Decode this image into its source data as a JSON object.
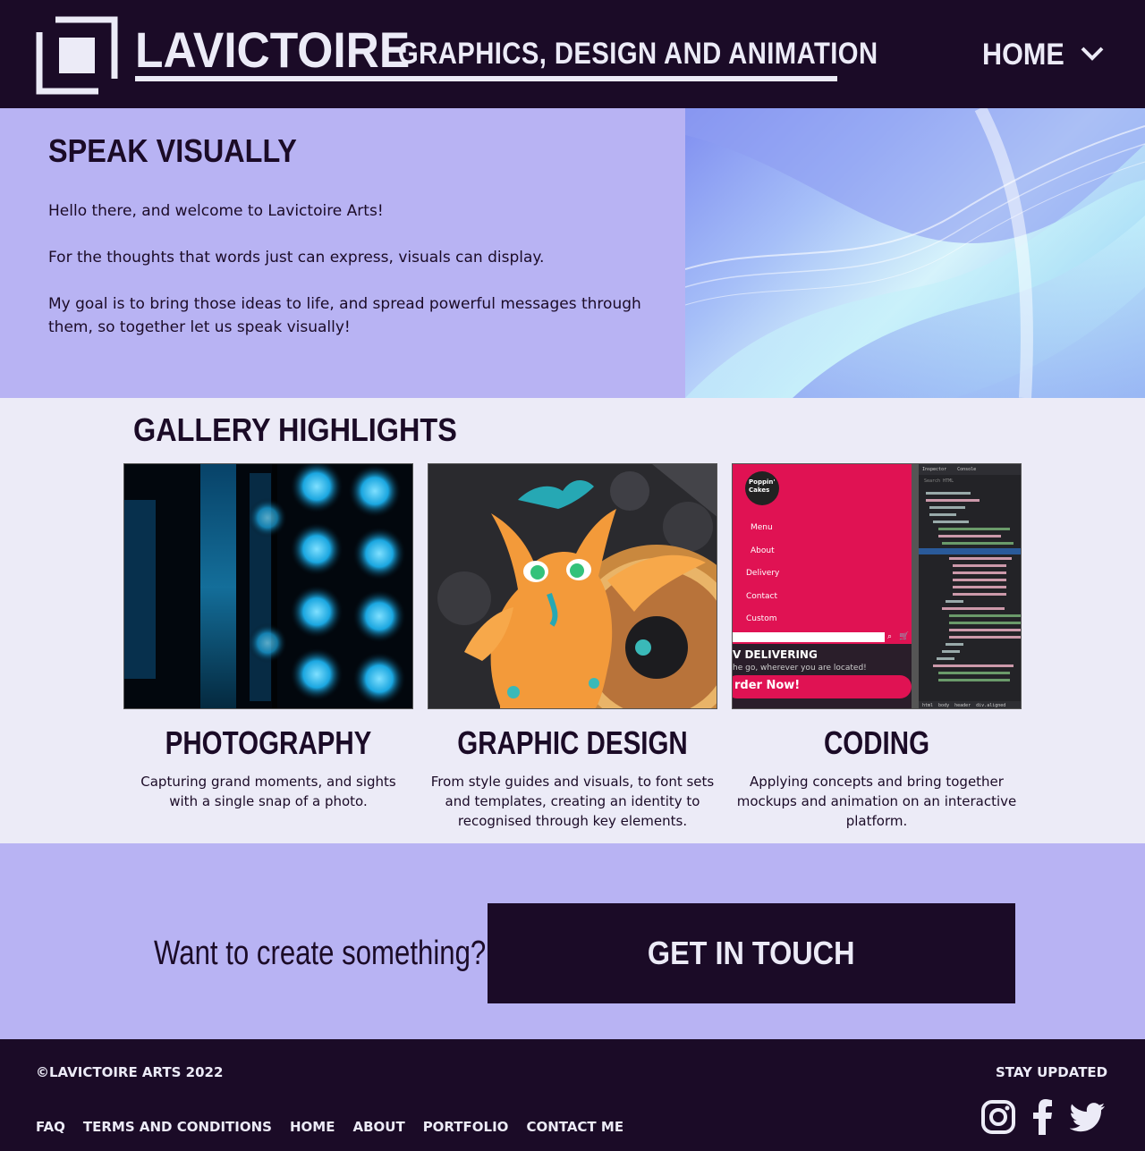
{
  "header": {
    "brand": "LAVICTOIRE",
    "tagline": "GRAPHICS, DESIGN AND ANIMATION",
    "nav_label": "HOME"
  },
  "hero": {
    "title": "SPEAK VISUALLY",
    "paragraphs": [
      "Hello there, and welcome to Lavictoire Arts!",
      "For the thoughts that words just can express, visuals can display.",
      "My goal is to bring those ideas to life, and spread powerful messages through them, so together let us speak visually!"
    ]
  },
  "gallery": {
    "title": "GALLERY HIGHLIGHTS",
    "cards": [
      {
        "title": "PHOTOGRAPHY",
        "description": "Capturing grand moments, and sights with a single snap of a photo."
      },
      {
        "title": "GRAPHIC DESIGN",
        "description": "From style guides and visuals, to font sets and templates, creating an identity to recognised through key elements."
      },
      {
        "title": "CODING",
        "description": "Applying concepts and bring together mockups and animation on an interactive platform."
      }
    ],
    "coding_mock": {
      "site_name_line1": "Poppin'",
      "site_name_line2": "Cakes",
      "menu": [
        "Menu",
        "About",
        "Delivery",
        "Contact",
        "Custom"
      ],
      "banner_heading": "V DELIVERING",
      "banner_sub": "he go, wherever you are located!",
      "order_button": "rder Now!",
      "devtools_tabs": [
        "Inspector",
        "Console"
      ],
      "devtools_search": "Search HTML",
      "devtools_breadcrumb": [
        "html",
        "body",
        "header",
        "div.aligned"
      ]
    }
  },
  "cta": {
    "question": "Want to create something?",
    "button": "GET IN TOUCH"
  },
  "footer": {
    "copyright": "©LAVICTOIRE ARTS 2022",
    "stay_updated": "STAY UPDATED",
    "links": [
      "FAQ",
      "TERMS AND CONDITIONS",
      "HOME",
      "ABOUT",
      "PORTFOLIO",
      "CONTACT ME"
    ],
    "social_icons": [
      "instagram-icon",
      "facebook-icon",
      "twitter-icon"
    ]
  },
  "colors": {
    "dark": "#1b0b27",
    "lavender": "#b8b3f3",
    "light": "#ecebf7",
    "coding_pink": "#e01253"
  }
}
